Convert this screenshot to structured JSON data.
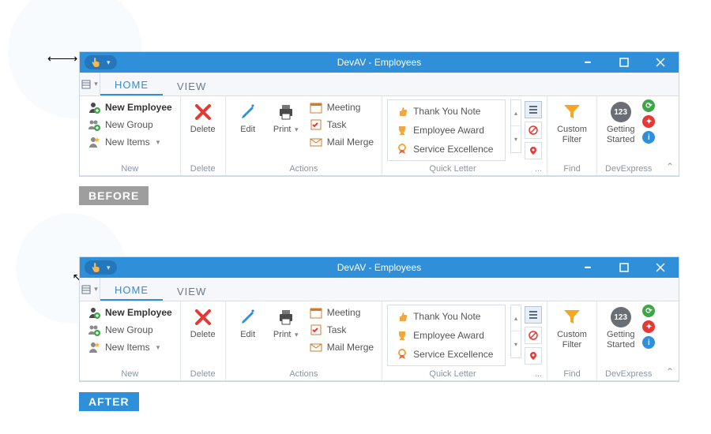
{
  "labels": {
    "before": "BEFORE",
    "after": "AFTER"
  },
  "arrows": {
    "horiz": "⟵⟶",
    "diag": "⟵⟶"
  },
  "window": {
    "title": "DevAV - Employees",
    "tabs": {
      "home": "HOME",
      "view": "VIEW"
    },
    "groups": {
      "new": {
        "label": "New",
        "newEmployee": "New Employee",
        "newGroup": "New Group",
        "newItems": "New Items"
      },
      "delete": {
        "label": "Delete",
        "btn": "Delete"
      },
      "actions": {
        "label": "Actions",
        "edit": "Edit",
        "print": "Print",
        "meeting": "Meeting",
        "task": "Task",
        "mailMerge": "Mail Merge"
      },
      "quickLetter": {
        "label": "Quick Letter",
        "thank": "Thank You Note",
        "award": "Employee Award",
        "service": "Service Excellence",
        "overflow": "..."
      },
      "find": {
        "label": "Find",
        "custom": "Custom",
        "filter": "Filter"
      },
      "dev": {
        "label": "DevExpress",
        "badge": "123",
        "getting": "Getting",
        "started": "Started"
      }
    }
  }
}
